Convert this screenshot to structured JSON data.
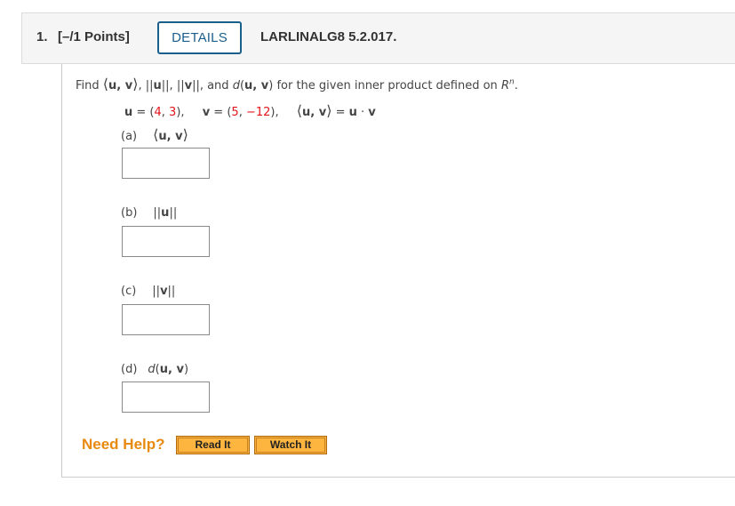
{
  "question": {
    "number": "1.",
    "points": "[–/1 Points]",
    "details_label": "DETAILS",
    "code": "LARLINALG8 5.2.017."
  },
  "prompt": {
    "find": "Find ",
    "uv_inner": "u, v",
    "sep1": ", ",
    "norm_u": "u",
    "sep2": ", ",
    "norm_v": "v",
    "and": ", and ",
    "d": "d",
    "d_args": "u, v",
    "tail": " for the given inner product defined on ",
    "space": "R",
    "space_sup": "n",
    "period": "."
  },
  "given": {
    "u_name": "u",
    "u_eq": " = (",
    "u_vals": [
      "4",
      "3"
    ],
    "v_name": "v",
    "v_eq": " = (",
    "v_vals": [
      "5",
      "−12"
    ],
    "inner_def_lhs": "u, v",
    "inner_def_eq": " = ",
    "inner_def_u": "u",
    "inner_def_dot": " · ",
    "inner_def_v": "v"
  },
  "parts": [
    {
      "label": "(a)",
      "expr": "u, v",
      "kind": "inner",
      "answer": ""
    },
    {
      "label": "(b)",
      "expr": "u",
      "kind": "norm",
      "answer": ""
    },
    {
      "label": "(c)",
      "expr": "v",
      "kind": "norm",
      "answer": ""
    },
    {
      "label": "(d)",
      "expr": "u, v",
      "kind": "distance",
      "answer": ""
    }
  ],
  "help": {
    "label": "Need Help?",
    "read_it": "Read It",
    "watch_it": "Watch It"
  },
  "colors": {
    "accent_blue": "#1b5f8c",
    "help_orange": "#e88a0f",
    "button_orange": "#fdb53f",
    "given_value_red": "#e2141a"
  }
}
